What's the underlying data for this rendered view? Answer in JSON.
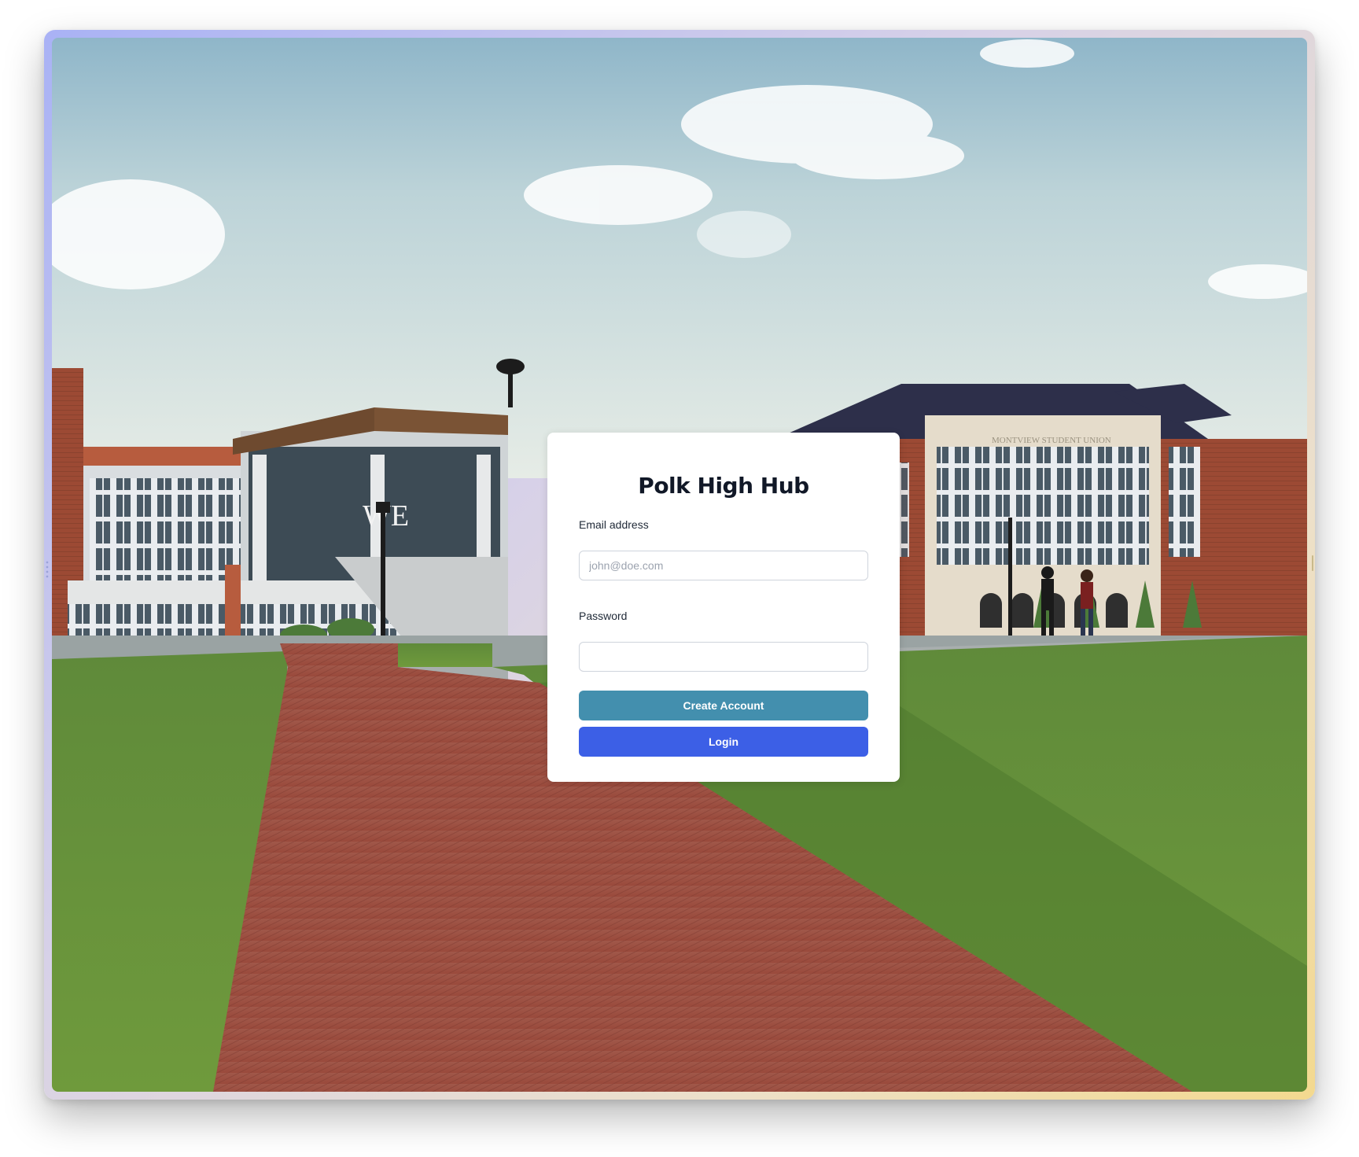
{
  "login": {
    "title": "Polk High Hub",
    "email_label": "Email address",
    "email_placeholder": "john@doe.com",
    "email_value": "",
    "password_label": "Password",
    "password_value": "",
    "create_account_label": "Create Account",
    "login_label": "Login"
  },
  "background": {
    "description_icon": "campus-photo",
    "sign_text_left": "WE",
    "sign_text_right": "MONTVIEW STUDENT UNION"
  },
  "colors": {
    "create_account_button": "#438fae",
    "login_button": "#3c5fe6",
    "title_text": "#111827",
    "frame_gradient_start": "#a9b2f5",
    "frame_gradient_end": "#f3d98f"
  }
}
